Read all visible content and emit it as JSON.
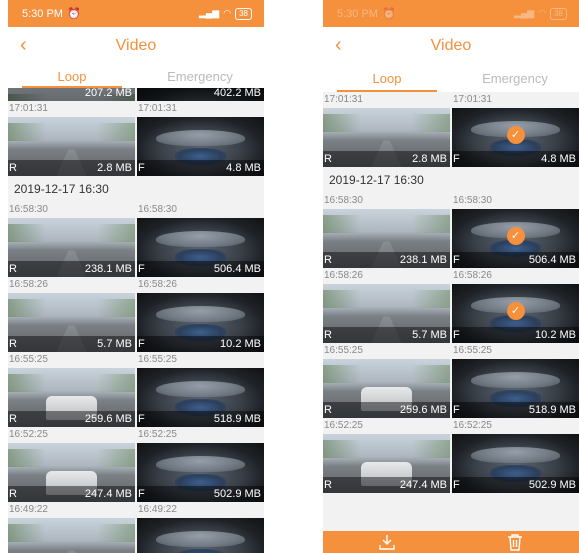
{
  "status_bar": {
    "time": "5:30 PM",
    "alarm_icon": "alarm-icon",
    "signal_icon": "signal-icon",
    "wifi_icon": "wifi-icon",
    "battery": "38"
  },
  "header": {
    "title": "Video",
    "back_icon": "chevron-left-icon"
  },
  "tabs": [
    {
      "label": "Loop",
      "active": true
    },
    {
      "label": "Emergency",
      "active": false
    }
  ],
  "colors": {
    "accent": "#f5913c",
    "background": "#f2f2f2"
  },
  "left_screen": {
    "partial_top": {
      "r_size": "207.2 MB",
      "f_size": "402.2 MB"
    },
    "groups": [
      {
        "time_r": "17:01:31",
        "time_f": "17:01:31",
        "r_tag": "R",
        "r_size": "2.8 MB",
        "f_tag": "F",
        "f_size": "4.8 MB"
      }
    ],
    "date_header": "2019-12-17 16:30",
    "groups2": [
      {
        "time_r": "16:58:30",
        "time_f": "16:58:30",
        "r_tag": "R",
        "r_size": "238.1 MB",
        "f_tag": "F",
        "f_size": "506.4 MB"
      },
      {
        "time_r": "16:58:26",
        "time_f": "16:58:26",
        "r_tag": "R",
        "r_size": "5.7 MB",
        "f_tag": "F",
        "f_size": "10.2 MB"
      },
      {
        "time_r": "16:55:25",
        "time_f": "16:55:25",
        "r_tag": "R",
        "r_size": "259.6 MB",
        "f_tag": "F",
        "f_size": "518.9 MB"
      },
      {
        "time_r": "16:52:25",
        "time_f": "16:52:25",
        "r_tag": "R",
        "r_size": "247.4 MB",
        "f_tag": "F",
        "f_size": "502.9 MB"
      }
    ],
    "last_times": {
      "time_r": "16:49:22",
      "time_f": "16:49:22"
    }
  },
  "right_screen": {
    "groups": [
      {
        "time_r": "17:01:31",
        "time_f": "17:01:31",
        "r_tag": "R",
        "r_size": "2.8 MB",
        "f_tag": "F",
        "f_size": "4.8 MB",
        "f_checked": true
      }
    ],
    "date_header": "2019-12-17 16:30",
    "groups2": [
      {
        "time_r": "16:58:30",
        "time_f": "16:58:30",
        "r_tag": "R",
        "r_size": "238.1 MB",
        "f_tag": "F",
        "f_size": "506.4 MB",
        "f_checked": true
      },
      {
        "time_r": "16:58:26",
        "time_f": "16:58:26",
        "r_tag": "R",
        "r_size": "5.7 MB",
        "f_tag": "F",
        "f_size": "10.2 MB",
        "f_checked": true
      },
      {
        "time_r": "16:55:25",
        "time_f": "16:55:25",
        "r_tag": "R",
        "r_size": "259.6 MB",
        "f_tag": "F",
        "f_size": "518.9 MB",
        "f_checked": false
      },
      {
        "time_r": "16:52:25",
        "time_f": "16:52:25",
        "r_tag": "R",
        "r_size": "247.4 MB",
        "f_tag": "F",
        "f_size": "502.9 MB",
        "f_checked": false
      }
    ],
    "check_icon": "checkmark-icon",
    "bottom_actions": {
      "download_icon": "download-icon",
      "delete_icon": "trash-icon"
    }
  }
}
